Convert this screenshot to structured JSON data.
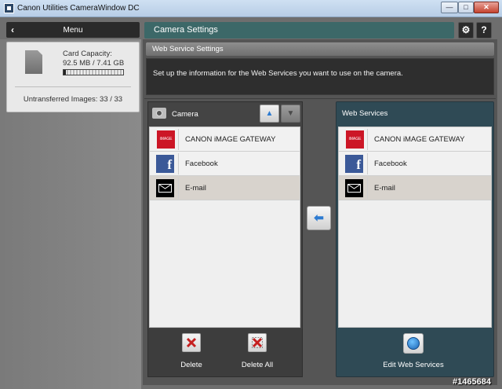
{
  "window": {
    "title": "Canon Utilities CameraWindow DC",
    "min_label": "—",
    "max_label": "□",
    "close_label": "✕"
  },
  "left": {
    "menu_label": "Menu",
    "menu_back": "‹",
    "card_capacity_label": "Card Capacity:",
    "card_capacity_value": "92.5 MB / 7.41 GB",
    "card_used_fraction": 0.012,
    "untransferred": "Untransferred Images: 33 / 33"
  },
  "header": {
    "title": "Camera Settings",
    "gear_icon": "⚙",
    "help_label": "?"
  },
  "section": {
    "title": "Web Service Settings",
    "instructions": "Set up the information for the Web Services you want to use on the camera."
  },
  "camera_panel": {
    "title": "Camera",
    "up_label": "▲",
    "down_label": "▼",
    "items": [
      {
        "label": "CANON iMAGE GATEWAY",
        "icon": "image-gateway-icon",
        "icon_text": "iMAGE"
      },
      {
        "label": "Facebook",
        "icon": "facebook-icon",
        "icon_text": "f"
      },
      {
        "label": "E-mail",
        "icon": "email-icon",
        "selected": true
      }
    ],
    "delete_label": "Delete",
    "delete_all_label": "Delete All"
  },
  "transfer": {
    "arrow": "⬅"
  },
  "web_services_panel": {
    "title": "Web Services",
    "items": [
      {
        "label": "CANON iMAGE GATEWAY",
        "icon": "image-gateway-icon",
        "icon_text": "iMAGE"
      },
      {
        "label": "Facebook",
        "icon": "facebook-icon",
        "icon_text": "f"
      },
      {
        "label": "E-mail",
        "icon": "email-icon",
        "selected": true
      }
    ],
    "edit_label": "Edit Web Services"
  },
  "watermark": "#1465684",
  "colors": {
    "header_teal": "#3c6868",
    "web_services_panel": "#2f4a55",
    "accent_blue": "#2d7bd1",
    "gateway_red": "#cc1626",
    "facebook_blue": "#3b5998"
  }
}
